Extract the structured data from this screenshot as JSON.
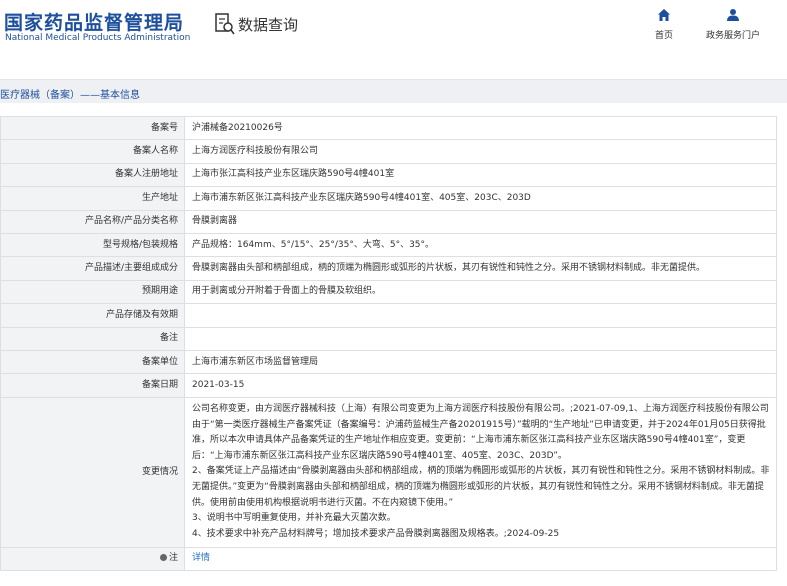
{
  "header": {
    "logo_cn": "国家药品监督管理局",
    "logo_en": "National Medical Products Administration",
    "query_title": "数据查询",
    "nav": [
      {
        "label": "首页",
        "icon": "home-icon"
      },
      {
        "label": "政务服务门户",
        "icon": "user-icon"
      }
    ]
  },
  "section_title": "医疗器械（备案）——基本信息",
  "rows": [
    {
      "label": "备案号",
      "value": "沪浦械备20210026号"
    },
    {
      "label": "备案人名称",
      "value": "上海方润医疗科技股份有限公司"
    },
    {
      "label": "备案人注册地址",
      "value": "上海市张江高科技产业东区瑞庆路590号4幢401室"
    },
    {
      "label": "生产地址",
      "value": "上海市浦东新区张江高科技产业东区瑞庆路590号4幢401室、405室、203C、203D"
    },
    {
      "label": "产品名称/产品分类名称",
      "value": "骨膜剥离器"
    },
    {
      "label": "型号规格/包装规格",
      "value": "产品规格：164mm、5°/15°、25°/35°、大弯、5°、35°。"
    },
    {
      "label": "产品描述/主要组成成分",
      "value": "骨膜剥离器由头部和柄部组成，柄的顶端为椭圆形或弧形的片状板，其刃有锐性和钝性之分。采用不锈钢材料制成。非无菌提供。"
    },
    {
      "label": "预期用途",
      "value": "用于剥离或分开附着于骨面上的骨膜及软组织。"
    },
    {
      "label": "产品存储及有效期",
      "value": ""
    },
    {
      "label": "备注",
      "value": ""
    },
    {
      "label": "备案单位",
      "value": "上海市浦东新区市场监督管理局"
    },
    {
      "label": "备案日期",
      "value": "2021-03-15"
    }
  ],
  "change": {
    "label": "变更情况",
    "lines": [
      "公司名称变更，由方润医疗器械科技（上海）有限公司变更为上海方润医疗科技股份有限公司。;2021-07-09,1、上海方润医疗科技股份有限公司由于“第一类医疗器械生产备案凭证（备案编号：沪浦药监械生产备20201915号）”载明的“生产地址”已申请变更，并于2024年01月05日获得批准，所以本次申请具体产品备案凭证的生产地址作相应变更。变更前：“上海市浦东新区张江高科技产业东区瑞庆路590号4幢401室”，变更后：“上海市浦东新区张江高科技产业东区瑞庆路590号4幢401室、405室、203C、203D”。",
      "2、备案凭证上产品描述由“骨膜剥离器由头部和柄部组成，柄的顶端为椭圆形或弧形的片状板，其刃有锐性和钝性之分。采用不锈钢材料制成。非无菌提供。”变更为“骨膜剥离器由头部和柄部组成，柄的顶端为椭圆形或弧形的片状板，其刃有锐性和钝性之分。采用不锈钢材料制成。非无菌提供。使用前由使用机构根据说明书进行灭菌。不在内窥镜下使用。”",
      "3、说明书中写明重复使用，并补充最大灭菌次数。",
      "4、技术要求中补充产品材料牌号；增加技术要求产品骨膜剥离器图及规格表。;2024-09-25"
    ]
  },
  "note": {
    "label": "注",
    "link": "详情"
  },
  "colors": {
    "brand": "#1d4f9c",
    "link": "#1d6fc4",
    "label_bg": "#f2f3f5",
    "border": "#dcdfe4"
  }
}
